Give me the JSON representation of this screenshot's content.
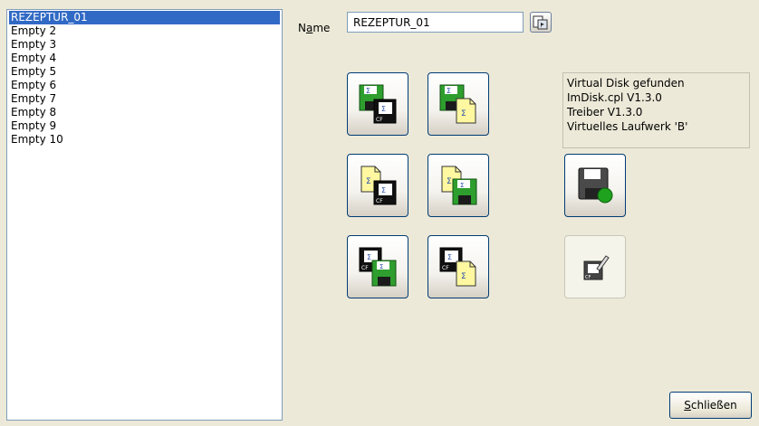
{
  "recipe_list": {
    "items": [
      "REZEPTUR_01",
      "Empty 2",
      "Empty 3",
      "Empty 4",
      "Empty 5",
      "Empty 6",
      "Empty 7",
      "Empty 8",
      "Empty 9",
      "Empty 10"
    ],
    "selected_index": 0
  },
  "name_field": {
    "label_prefix": "N",
    "label_underlined": "a",
    "label_suffix": "me",
    "value": "REZEPTUR_01"
  },
  "icons": {
    "browse": "browse-folder-icon",
    "disk_to_cf": "floppy-to-cf-card-icon",
    "disk_to_file": "floppy-to-file-icon",
    "file_to_cf": "file-to-cf-card-icon",
    "file_to_disk": "file-to-floppy-icon",
    "cf_to_disk": "cf-card-to-floppy-icon",
    "cf_to_file": "cf-card-to-file-icon",
    "mount_disk": "floppy-mount-icon",
    "edit_cf": "cf-card-edit-icon"
  },
  "status": {
    "lines": [
      "Virtual Disk gefunden",
      "ImDisk.cpl V1.3.0",
      "Treiber V1.3.0",
      "Virtuelles Laufwerk 'B'"
    ]
  },
  "close_button": {
    "label_underlined": "S",
    "label_rest": "chließen"
  },
  "colors": {
    "selection": "#316ac5",
    "window_bg": "#ece9d8",
    "floppy_green": "#2e9e2e",
    "card_black": "#111111",
    "file_yellow": "#fff8a0"
  }
}
